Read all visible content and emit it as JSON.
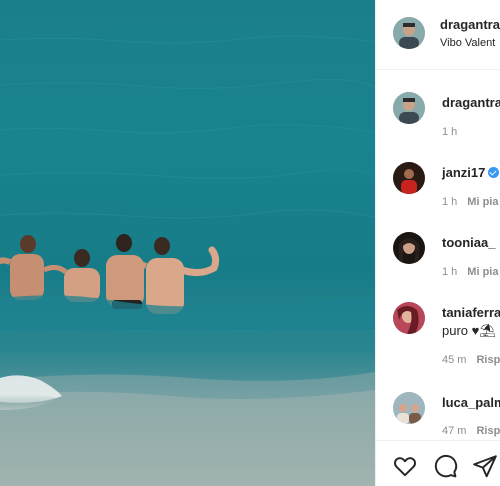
{
  "post": {
    "author": "dragantra",
    "location": "Vibo Valent"
  },
  "comments": [
    {
      "username": "dragantra",
      "text": "",
      "time": "1 h",
      "reply": ""
    },
    {
      "username": "janzi17",
      "verified": true,
      "text": "",
      "time": "1 h",
      "reply": "Mi pia"
    },
    {
      "username": "tooniaa_",
      "text": "",
      "time": "1 h",
      "reply": "Mi pia"
    },
    {
      "username": "taniaferra",
      "text": "puro ♥⛱",
      "time": "45 m",
      "reply": "Risp"
    },
    {
      "username": "luca_palm",
      "text": "",
      "time": "47 m",
      "reply": "Risp"
    }
  ],
  "actions": {
    "like_icon": "heart-icon",
    "comment_icon": "comment-bubble-icon",
    "share_icon": "paper-plane-icon"
  },
  "colors": {
    "sea": "#1b7f8b",
    "accent_verified": "#3897f0",
    "muted_text": "#8e8e8e"
  }
}
